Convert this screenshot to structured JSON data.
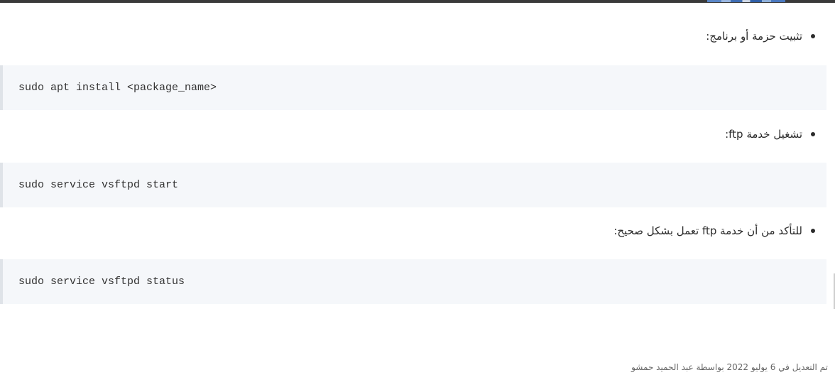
{
  "steps": [
    {
      "label": "تثبيت حزمة أو برنامج:",
      "command": "sudo apt install <package_name>"
    },
    {
      "label": "تشغيل خدمة ftp:",
      "command": "sudo service vsftpd start"
    },
    {
      "label": "للتأكد من أن خدمة ftp تعمل بشكل صحيح:",
      "command": "sudo service vsftpd status"
    }
  ],
  "footer": {
    "text": "تم التعديل في 6 يوليو 2022 بواسطة عبد الحميد حمشو"
  }
}
